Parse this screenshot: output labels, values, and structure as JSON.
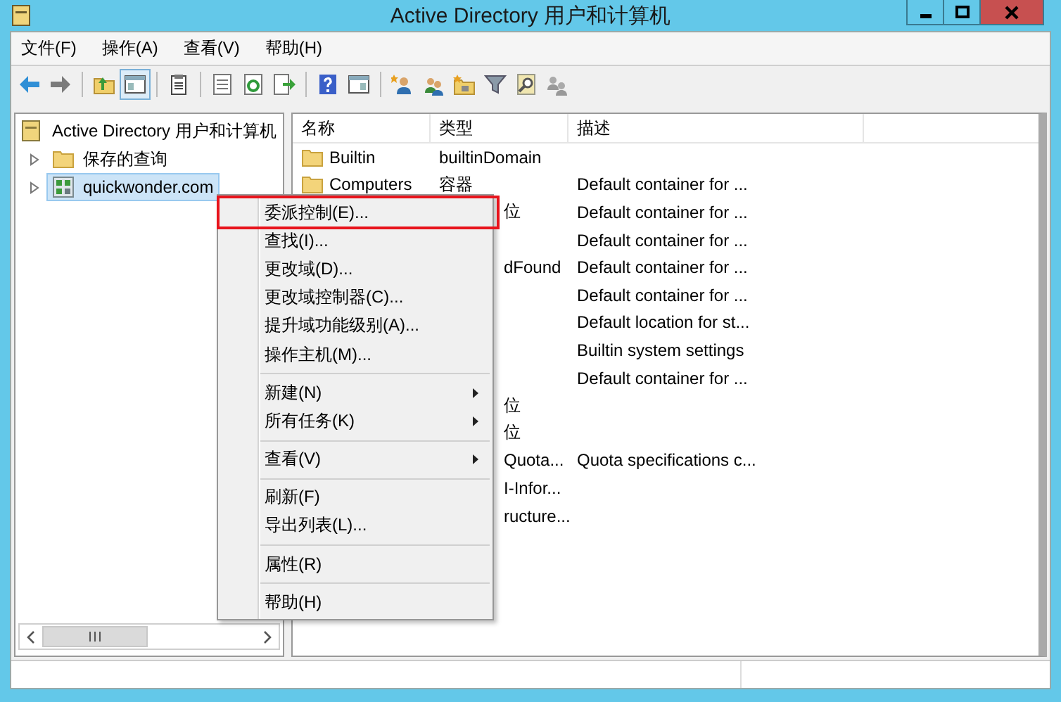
{
  "window": {
    "title": "Active Directory 用户和计算机"
  },
  "menu_bar": [
    "文件(F)",
    "操作(A)",
    "查看(V)",
    "帮助(H)"
  ],
  "toolbar": [
    {
      "kind": "back",
      "pressed": false
    },
    {
      "kind": "forward",
      "pressed": false
    },
    {
      "kind": "separator"
    },
    {
      "kind": "up",
      "pressed": false
    },
    {
      "kind": "tree",
      "pressed": true
    },
    {
      "kind": "separator"
    },
    {
      "kind": "clipboard",
      "pressed": false
    },
    {
      "kind": "separator"
    },
    {
      "kind": "sheet",
      "pressed": false
    },
    {
      "kind": "refresh",
      "pressed": false
    },
    {
      "kind": "export",
      "pressed": false
    },
    {
      "kind": "separator"
    },
    {
      "kind": "help",
      "pressed": false
    },
    {
      "kind": "pane",
      "pressed": false
    },
    {
      "kind": "separator"
    },
    {
      "kind": "user",
      "pressed": false
    },
    {
      "kind": "group",
      "pressed": false
    },
    {
      "kind": "ou",
      "pressed": false
    },
    {
      "kind": "filter",
      "pressed": false
    },
    {
      "kind": "find",
      "pressed": false
    },
    {
      "kind": "users",
      "pressed": false
    }
  ],
  "tree": {
    "label": "Active Directory 用户和计算机",
    "kind": "console",
    "selected": false,
    "children": [
      {
        "label": "保存的查询",
        "kind": "folder",
        "expanded": false,
        "selected": false
      },
      {
        "label": "quickwonder.com",
        "kind": "domain",
        "expanded": false,
        "selected": true
      }
    ]
  },
  "table": {
    "columns": [
      "名称",
      "类型",
      "描述"
    ],
    "rows": [
      {
        "name": "Builtin",
        "type": "builtinDomain"
      },
      {
        "name": "Computers",
        "type": "容器",
        "description": "Default container for ..."
      },
      {
        "type": "位",
        "type_cut": true,
        "description": "Default container for ..."
      },
      {
        "description": "Default container for ..."
      },
      {
        "type": "dFound",
        "type_cut": true,
        "description": "Default container for ..."
      },
      {
        "description": "Default container for ..."
      },
      {
        "description": "Default location for st..."
      },
      {
        "description": "Builtin system settings"
      },
      {
        "description": "Default container for ..."
      },
      {
        "type": "位",
        "type_cut": true
      },
      {
        "type": "位",
        "type_cut": true
      },
      {
        "type": "Quota...",
        "type_cut": true,
        "description": "Quota specifications c..."
      },
      {
        "type": "I-Infor...",
        "type_cut": true
      },
      {
        "type": "ructure...",
        "type_cut": true
      }
    ]
  },
  "context_menu": [
    {
      "kind": "item",
      "label": "委派控制(E)...",
      "highlighted": true
    },
    {
      "kind": "item",
      "label": "查找(I)...",
      "highlighted": false
    },
    {
      "kind": "item",
      "label": "更改域(D)...",
      "highlighted": false
    },
    {
      "kind": "item",
      "label": "更改域控制器(C)...",
      "highlighted": false
    },
    {
      "kind": "item",
      "label": "提升域功能级别(A)...",
      "highlighted": false
    },
    {
      "kind": "item",
      "label": "操作主机(M)...",
      "highlighted": false
    },
    {
      "kind": "separator"
    },
    {
      "kind": "submenu",
      "label": "新建(N)",
      "highlighted": false
    },
    {
      "kind": "submenu",
      "label": "所有任务(K)",
      "highlighted": false
    },
    {
      "kind": "separator"
    },
    {
      "kind": "submenu",
      "label": "查看(V)",
      "highlighted": false
    },
    {
      "kind": "separator"
    },
    {
      "kind": "item",
      "label": "刷新(F)",
      "highlighted": false
    },
    {
      "kind": "item",
      "label": "导出列表(L)...",
      "highlighted": false
    },
    {
      "kind": "separator"
    },
    {
      "kind": "item",
      "label": "属性(R)",
      "highlighted": false
    },
    {
      "kind": "separator"
    },
    {
      "kind": "item",
      "label": "帮助(H)",
      "highlighted": false
    }
  ]
}
